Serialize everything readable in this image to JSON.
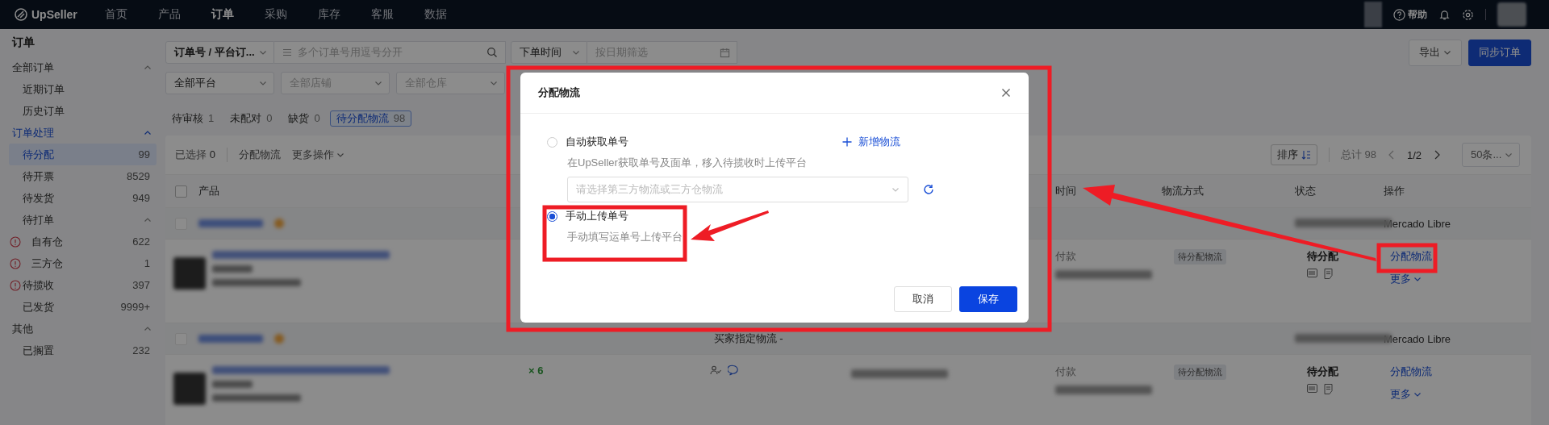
{
  "top_nav": {
    "logo": "UpSeller",
    "items": [
      {
        "label": "首页",
        "selected": false
      },
      {
        "label": "产品",
        "selected": false
      },
      {
        "label": "订单",
        "selected": true
      },
      {
        "label": "采购",
        "selected": false
      },
      {
        "label": "库存",
        "selected": false
      },
      {
        "label": "客服",
        "selected": false
      },
      {
        "label": "数据",
        "selected": false
      }
    ],
    "help": "帮助"
  },
  "sidebar": {
    "title": "订单",
    "groups": [
      {
        "label": "全部订单",
        "expanded": true,
        "selected": false,
        "children": [
          {
            "label": "近期订单",
            "selected": false
          },
          {
            "label": "历史订单",
            "selected": false
          }
        ]
      },
      {
        "label": "订单处理",
        "expanded": true,
        "selected": true,
        "children": [
          {
            "label": "待分配",
            "count": "99",
            "selected": true,
            "warning": false
          },
          {
            "label": "待开票",
            "count": "8529",
            "selected": false,
            "warning": false
          },
          {
            "label": "待发货",
            "count": "949",
            "selected": false,
            "warning": false
          },
          {
            "label": "待打单",
            "expanded": true,
            "selected": false,
            "warning": false,
            "children": [
              {
                "label": "自有仓",
                "count": "622",
                "selected": false,
                "warning": true
              },
              {
                "label": "三方仓",
                "count": "1",
                "selected": false,
                "warning": true
              }
            ]
          },
          {
            "label": "待揽收",
            "count": "397",
            "selected": false,
            "warning": true
          },
          {
            "label": "已发货",
            "count": "9999+",
            "selected": false,
            "warning": false
          }
        ]
      },
      {
        "label": "其他",
        "expanded": true,
        "selected": false,
        "children": [
          {
            "label": "已搁置",
            "count": "232",
            "selected": false,
            "warning": false
          }
        ]
      }
    ]
  },
  "filters": {
    "search_type": "订单号 / 平台订...",
    "search_placeholder": "多个订单号用逗号分开",
    "time_type": "下单时间",
    "date_placeholder": "按日期筛选",
    "selects": [
      {
        "value": "全部平台"
      },
      {
        "placeholder": "全部店铺"
      },
      {
        "placeholder": "全部仓库"
      }
    ]
  },
  "actions": {
    "export": "导出",
    "sync": "同步订单"
  },
  "status_tabs": [
    {
      "label": "待审核",
      "count": "1",
      "selected": false
    },
    {
      "label": "未配对",
      "count": "0",
      "selected": false
    },
    {
      "label": "缺货",
      "count": "0",
      "selected": false
    },
    {
      "label": "待分配物流",
      "count": "98",
      "selected": true
    }
  ],
  "toolbar": {
    "selected_label": "已选择",
    "selected_count": "0",
    "assign": "分配物流",
    "more": "更多操作",
    "sort": "排序",
    "total": "总计 98",
    "page": "1/2",
    "page_size": "50条..."
  },
  "table": {
    "select_all": {
      "checked": false
    },
    "columns": [
      "产品",
      "时间",
      "物流方式",
      "状态",
      "操作"
    ],
    "groups": [
      {
        "platform": "Mercado Libre",
        "checked": false,
        "rows": [
          {
            "payment": "付款",
            "logistics_tag": "待分配物流",
            "status": "待分配",
            "actions": [
              "分配物流",
              "更多"
            ]
          }
        ]
      },
      {
        "note": "买家指定物流 -",
        "platform": "Mercado Libre",
        "checked": false,
        "rows": [
          {
            "quantity": "× 6",
            "payment": "付款",
            "logistics_tag": "待分配物流",
            "status": "待分配",
            "actions": [
              "分配物流",
              "更多"
            ]
          }
        ]
      }
    ]
  },
  "dialog": {
    "title": "分配物流",
    "add_logistics": "新增物流",
    "select_placeholder": "请选择第三方物流或三方仓物流",
    "options": [
      {
        "label": "自动获取单号",
        "description": "在UpSeller获取单号及面单，移入待揽收时上传平台",
        "selected": false
      },
      {
        "label": "手动上传单号",
        "description": "手动填写运单号上传平台",
        "selected": true
      }
    ],
    "cancel": "取消",
    "save": "保存"
  }
}
